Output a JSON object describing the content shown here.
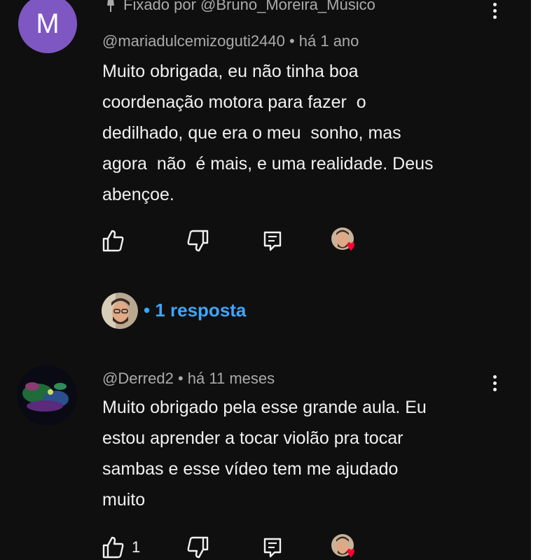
{
  "comment1": {
    "avatar_letter": "M",
    "pinned_text": "Fixado por @Bruno_Moreira_Músico",
    "author": "@mariadulcemizoguti2440",
    "time": "há 1 ano",
    "text_lines": [
      "Muito obrigada, eu não tinha boa",
      "coordenação motora para fazer  o",
      "dedilhado, que era o meu  sonho, mas",
      "agora  não  é mais, e uma realidade. Deus",
      "abençoe."
    ],
    "replies_label": "1 resposta"
  },
  "comment2": {
    "author": "@Derred2",
    "time": "há 11 meses",
    "text_lines": [
      "Muito obrigado pela esse grande aula. Eu",
      "estou aprender a tocar violão pra tocar",
      "sambas e esse vídeo tem me ajudado",
      "muito"
    ],
    "like_count": "1"
  },
  "icons": {
    "like": "thumb-up-outline-icon",
    "dislike": "thumb-down-outline-icon",
    "reply": "reply-comment-icon",
    "more": "more-vert-icon",
    "heart": "heart-icon",
    "pin": "pin-icon"
  },
  "colors": {
    "background": "#0f0f0f",
    "text": "#f1f1f1",
    "meta": "#aaaaaa",
    "link": "#3ea6ff",
    "heart": "#ff0033",
    "avatar": "#7e57c2"
  }
}
